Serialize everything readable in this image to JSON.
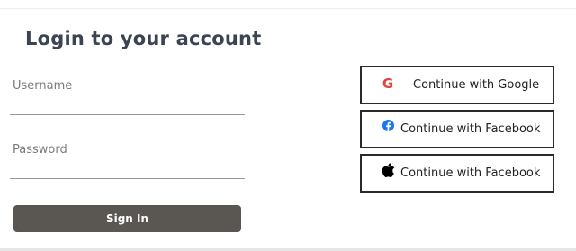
{
  "login": {
    "title": "Login to your account",
    "username_label": "Username",
    "username_value": "",
    "password_label": "Password",
    "password_value": "",
    "signin_label": "Sign In"
  },
  "social": {
    "google": {
      "label": "Continue with Google",
      "icon": "google-icon",
      "icon_glyph": "G",
      "color": "#e3423a"
    },
    "facebook": {
      "label": "Continue with Facebook",
      "icon": "facebook-icon",
      "color": "#1877f2"
    },
    "apple": {
      "label": "Continue with Facebook",
      "icon": "apple-icon",
      "color": "#000000"
    }
  },
  "colors": {
    "title": "#3b4450",
    "signin_bg": "#5a5752",
    "button_border": "#2a2a2a"
  }
}
